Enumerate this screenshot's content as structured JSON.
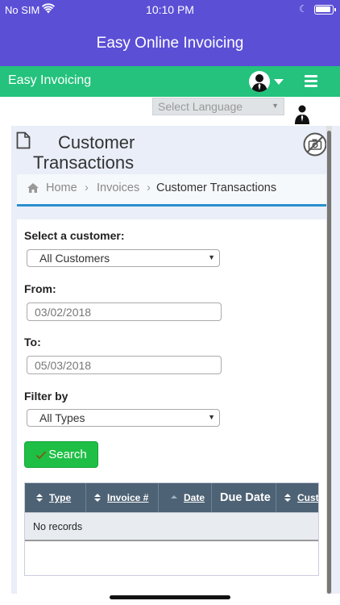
{
  "status_bar": {
    "carrier": "No SIM",
    "time": "10:10 PM"
  },
  "app": {
    "title": "Easy Online Invoicing"
  },
  "nav": {
    "brand": "Easy Invoicing"
  },
  "language": {
    "placeholder": "Select Language"
  },
  "page": {
    "title_line1": "Customer",
    "title_line2": "Transactions"
  },
  "breadcrumb": {
    "home": "Home",
    "invoices": "Invoices",
    "current": "Customer Transactions",
    "separator": "›"
  },
  "form": {
    "customer_label": "Select a customer:",
    "customer_value": "All Customers",
    "from_label": "From:",
    "from_value": "03/02/2018",
    "to_label": "To:",
    "to_value": "05/03/2018",
    "filter_label": "Filter by",
    "filter_value": "All Types",
    "search_label": "Search"
  },
  "table": {
    "columns": [
      "Type",
      "Invoice #",
      "Date",
      "Due Date",
      "Cust"
    ],
    "empty_text": "No records"
  },
  "colors": {
    "header_purple": "#5b4fd6",
    "nav_green": "#24c27c",
    "button_green": "#1fbf45",
    "table_header": "#4e6275",
    "breadcrumb_accent": "#2b8fcf"
  },
  "icons": [
    "wifi-icon",
    "moon-icon",
    "battery-icon",
    "avatar-icon",
    "caret-down-icon",
    "hamburger-icon",
    "document-icon",
    "no-camera-icon",
    "home-icon",
    "check-icon",
    "sort-icon"
  ]
}
